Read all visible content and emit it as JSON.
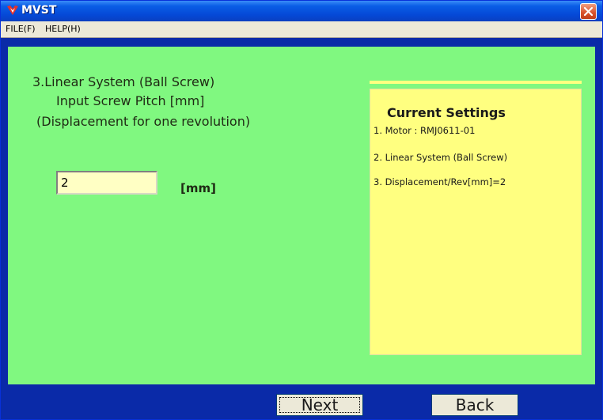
{
  "window": {
    "title": "MVST"
  },
  "menu": {
    "file": "FILE(F)",
    "help": "HELP(H)"
  },
  "main": {
    "heading_line1": "3.Linear System (Ball Screw)",
    "heading_line2": "Input Screw Pitch [mm]",
    "heading_line3": "(Displacement for one revolution)",
    "pitch_value": "2",
    "unit": "[mm]"
  },
  "settings": {
    "title": "Current Settings",
    "items": [
      "1. Motor : RMJ0611-01",
      "2. Linear System (Ball Screw)",
      "3. Displacement/Rev[mm]=2"
    ]
  },
  "buttons": {
    "next": "Next",
    "back": "Back"
  },
  "colors": {
    "panel_green": "#80f880",
    "settings_yellow": "#ffff80",
    "frame_blue": "#0a2aa8"
  },
  "icons": {
    "app": "app-logo-icon",
    "close": "close-icon"
  }
}
